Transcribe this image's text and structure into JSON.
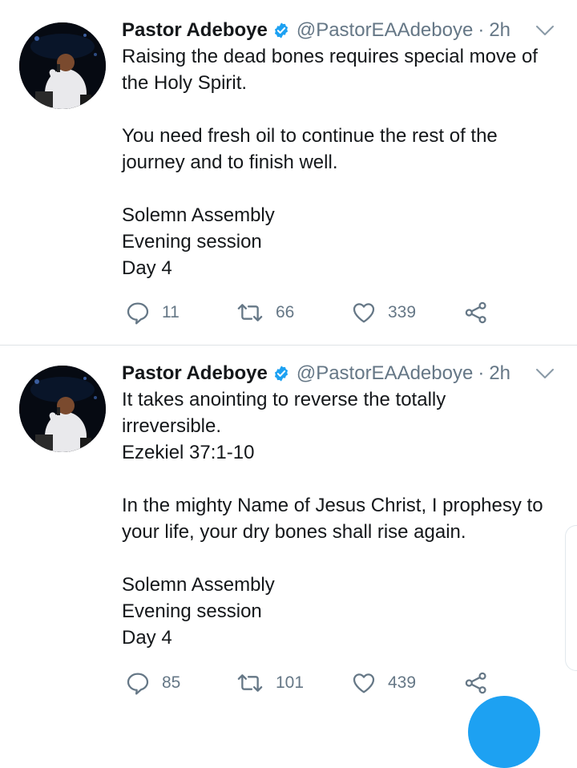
{
  "tweets": [
    {
      "author_name": "Pastor Adeboye",
      "handle": "@PastorEAAdeboye",
      "separator": "·",
      "time": "2h",
      "paragraphs": [
        [
          "Raising the dead bones requires special move of",
          "the Holy Spirit."
        ],
        [
          "You need fresh oil to continue the rest of the",
          "journey and to finish well."
        ],
        [
          "Solemn Assembly",
          "Evening session",
          "Day 4"
        ]
      ],
      "replies": "11",
      "retweets": "66",
      "likes": "339"
    },
    {
      "author_name": "Pastor Adeboye",
      "handle": "@PastorEAAdeboye",
      "separator": "·",
      "time": "2h",
      "paragraphs": [
        [
          "It takes anointing to reverse the totally",
          "irreversible.",
          "Ezekiel 37:1-10"
        ],
        [
          "In the mighty Name of Jesus Christ, I prophesy to",
          "your life, your dry bones shall rise again."
        ],
        [
          "Solemn Assembly",
          "Evening session",
          "Day 4"
        ]
      ],
      "replies": "85",
      "retweets": "101",
      "likes": "439"
    }
  ],
  "icons": {
    "verified": "verified-badge-icon",
    "caret": "chevron-down-icon",
    "reply": "reply-icon",
    "retweet": "retweet-icon",
    "like": "heart-icon",
    "share": "share-icon"
  },
  "colors": {
    "accent": "#1da1f2",
    "secondary_text": "#657786",
    "primary_text": "#14171a",
    "divider": "#dfe3e6"
  }
}
